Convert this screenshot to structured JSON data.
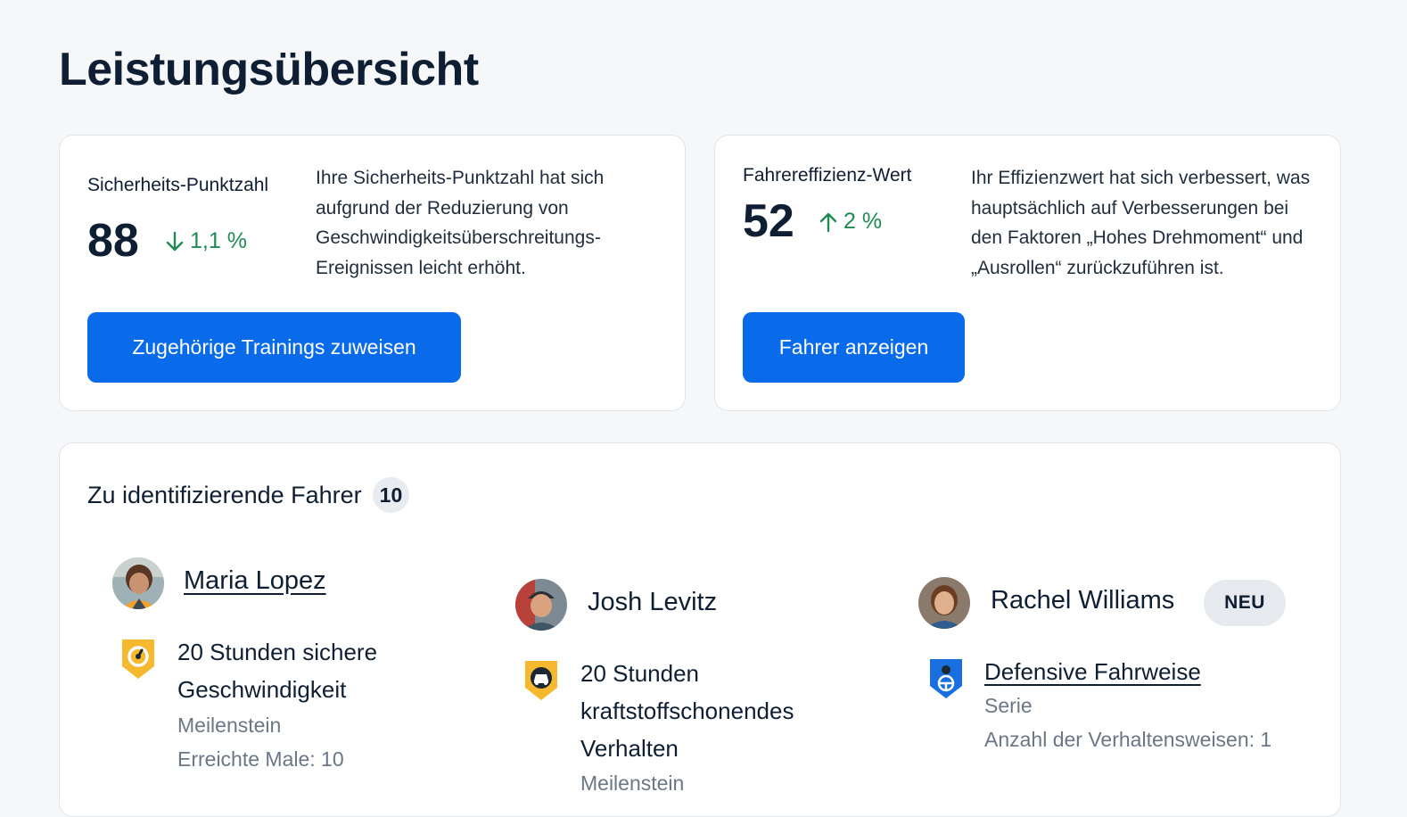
{
  "page": {
    "title": "Leistungsübersicht"
  },
  "safety": {
    "label": "Sicherheits-Punktzahl",
    "value": "88",
    "change": "1,1 %",
    "change_direction": "down",
    "description": "Ihre Sicherheits-Punktzahl hat sich aufgrund der Reduzierung von Geschwindigkeitsüberschreitungs-Ereignissen leicht erhöht.",
    "button_label": "Zugehörige Trainings zuweisen"
  },
  "efficiency": {
    "label": "Fahrereffizienz-Wert",
    "value": "52",
    "change": "2 %",
    "change_direction": "up",
    "description": "Ihr Effizienzwert hat sich verbessert, was hauptsächlich auf Verbesserungen bei den Faktoren „Hohes Drehmoment“ und „Ausrollen“ zurückzuführen ist.",
    "button_label": "Fahrer anzeigen"
  },
  "drivers_section": {
    "title": "Zu identifizierende Fahrer",
    "count": "10",
    "drivers": [
      {
        "name": "Maria Lopez",
        "achievement_title": "20 Stunden sichere Geschwindigkeit",
        "achievement_type": "Meilenstein",
        "detail": "Erreichte Male: 10",
        "icon": "speedometer-badge-icon"
      },
      {
        "name": "Josh Levitz",
        "achievement_title": "20 Stunden kraftstoffschonendes Verhalten",
        "achievement_type": "Meilenstein",
        "icon": "car-badge-icon"
      },
      {
        "name": "Rachel Williams",
        "badge": "NEU",
        "achievement_title": "Defensive Fahrweise",
        "achievement_type": "Serie",
        "detail": "Anzahl der Verhaltensweisen: 1",
        "icon": "steering-wheel-badge-icon"
      }
    ]
  },
  "colors": {
    "primary_button": "#0a6bea",
    "positive": "#1f8a52",
    "badge_gold": "#f5b82e",
    "badge_blue": "#1a6fe0"
  }
}
